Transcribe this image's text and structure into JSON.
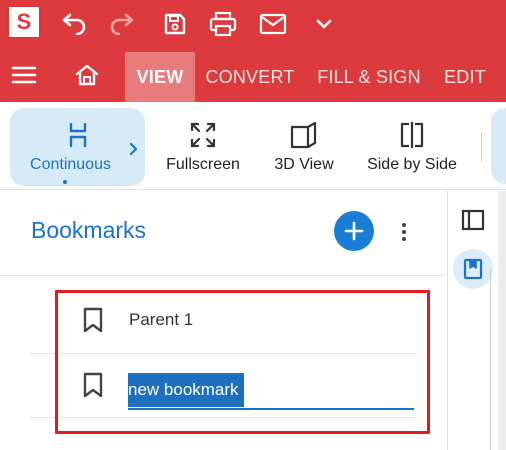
{
  "app": {
    "logo_letter": "S"
  },
  "titlebar": {
    "icons": [
      "undo-icon",
      "redo-icon",
      "save-icon",
      "print-icon",
      "mail-icon",
      "chevron-down-icon"
    ]
  },
  "menubar": {
    "tabs": [
      {
        "label": "VIEW",
        "active": true
      },
      {
        "label": "CONVERT",
        "active": false
      },
      {
        "label": "FILL & SIGN",
        "active": false
      },
      {
        "label": "EDIT",
        "active": false
      }
    ]
  },
  "toolbar": {
    "items": [
      {
        "label": "Continuous",
        "selected": true
      },
      {
        "label": "Fullscreen",
        "selected": false
      },
      {
        "label": "3D View",
        "selected": false
      },
      {
        "label": "Side by Side",
        "selected": false
      }
    ]
  },
  "bookmarks": {
    "title": "Bookmarks",
    "items": [
      {
        "label": "Parent 1"
      }
    ],
    "editing_value": "new bookmark"
  },
  "colors": {
    "brand_red": "#dd3a3e",
    "accent_blue": "#1a73c7",
    "highlight_red": "#e21b1b"
  }
}
